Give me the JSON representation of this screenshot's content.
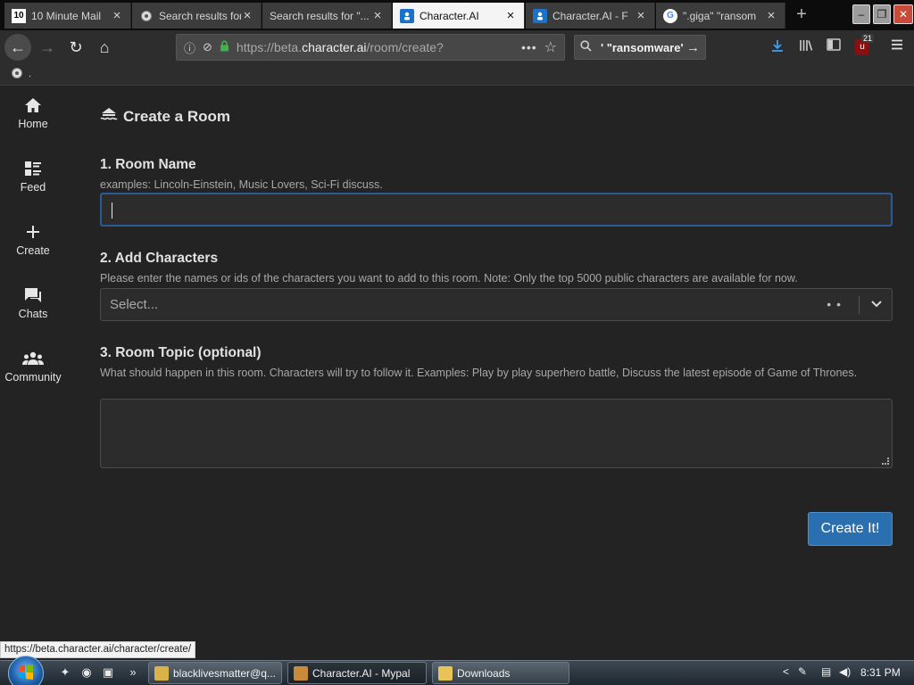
{
  "browser": {
    "tabs": [
      {
        "title": "10 Minute Mail",
        "icon": "ten-minute-mail-icon",
        "favicon_text": "10",
        "active": false
      },
      {
        "title": "Search results for",
        "icon": "search-favicon-icon",
        "active": false
      },
      {
        "title": "Search results for \"...",
        "icon": "none",
        "active": false
      },
      {
        "title": "Character.AI",
        "icon": "character-ai-icon",
        "active": true
      },
      {
        "title": "Character.AI - F",
        "icon": "character-ai-icon",
        "active": false
      },
      {
        "title": "\".giga\" \"ransom",
        "icon": "google-icon",
        "favicon_text": "G",
        "active": false
      }
    ],
    "close_glyph": "×",
    "new_tab_glyph": "+",
    "window_controls": {
      "minimize": "–",
      "restore": "❐",
      "close": "✕"
    },
    "nav": {
      "back": "←",
      "forward": "→",
      "reload": "↻",
      "home": "⌂"
    },
    "url": {
      "prefix": "https://beta.",
      "host": "character.ai",
      "path": "/room/create?",
      "more": "•••"
    },
    "search": {
      "value": "' \"ransomware'",
      "go": "→"
    },
    "ublock_badge": "21",
    "bookmark_label": "."
  },
  "sidebar": {
    "items": [
      {
        "label": "Home",
        "icon": "home-icon"
      },
      {
        "label": "Feed",
        "icon": "feed-icon"
      },
      {
        "label": "Create",
        "icon": "plus-icon"
      },
      {
        "label": "Chats",
        "icon": "chat-bubble-icon"
      },
      {
        "label": "Community",
        "icon": "community-icon"
      }
    ]
  },
  "form": {
    "page_title": "Create a Room",
    "room_name": {
      "heading": "1. Room Name",
      "hint": "examples: Lincoln-Einstein, Music Lovers, Sci-Fi discuss.",
      "value": ""
    },
    "characters": {
      "heading": "2. Add Characters",
      "hint": "Please enter the names or ids of the characters you want to add to this room. Note: Only the top 5000 public characters are available for now.",
      "placeholder": "Select...",
      "loading": "• •"
    },
    "topic": {
      "heading": "3. Room Topic (optional)",
      "hint": "What should happen in this room. Characters will try to follow it. Examples: Play by play superhero battle, Discuss the latest episode of Game of Thrones.",
      "value": ""
    },
    "submit_label": "Create It!"
  },
  "status_link": "https://beta.character.ai/character/create/",
  "taskbar": {
    "quicklaunch_more": "»",
    "tasks": [
      {
        "label": "blacklivesmatter@q...",
        "icon_color": "#d9b24a",
        "active": false
      },
      {
        "label": "Character.AI - Mypal",
        "icon_color": "#c98b3a",
        "active": true
      },
      {
        "label": "Downloads",
        "icon_color": "#e8c35a",
        "active": false
      }
    ],
    "tray_chevron": "<",
    "clock": "8:31 PM"
  },
  "colors": {
    "page_bg": "#232323",
    "accent_button": "#2a70b0",
    "focus_border": "#2b5b93",
    "ssl_lock": "#3fb24f",
    "download_icon": "#3ea0f0"
  }
}
